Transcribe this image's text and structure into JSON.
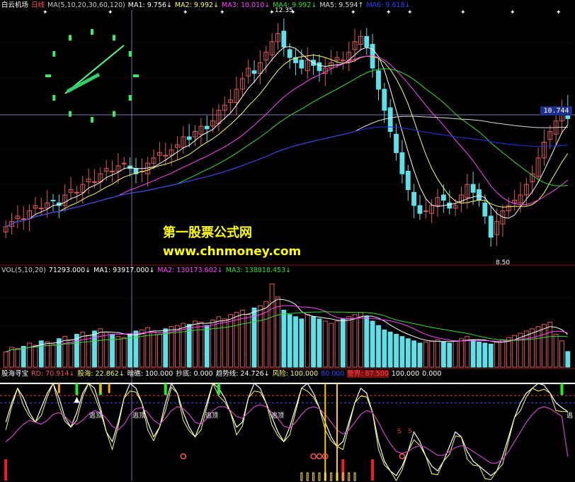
{
  "colors": {
    "background": "#000000",
    "up_candle": "#e05a5a",
    "down_candle": "#5fe0e8",
    "ma1": "#ffffff",
    "ma2": "#ffff66",
    "ma3": "#ff44ff",
    "ma4": "#33dd33",
    "ma5": "#dddddd",
    "ma6": "#2233ee",
    "hline": "#6a6a90",
    "osc_white": "#ffffff",
    "osc_yellow": "#ffff66",
    "osc_magenta": "#cc44cc",
    "osc_green": "#22ee22",
    "osc_orange": "#ffaa00",
    "osc_red": "#ee2222"
  },
  "header": {
    "title": "白云机场",
    "period": "日线",
    "ma_params": "MA(5,10,20,30,60,120)",
    "ma1": "MA1: 9.756↓",
    "ma2": "MA2: 9.992↓",
    "ma3": "MA3: 10.010↓",
    "ma4": "MA4: 9.992↓",
    "ma5": "MA5: 9.594↑",
    "ma6": "MA6: 9.618↓"
  },
  "vol_header": {
    "params": "VOL(5,10,20)",
    "vol": "71293.000↓",
    "ma1": "MA1: 93917.000↓",
    "ma2": "MA2: 130173.602↓",
    "ma3": "MA3: 138818.453↓"
  },
  "osc_header": {
    "name": "股海寻宝",
    "rd": "RD: 70.914↓",
    "gh": "股海: 22.862↓",
    "aj": "暗礁: 100.000",
    "cd": "抄底: 0.000",
    "qs": "趋势线: 24.726↓",
    "fx": "风险: 100.000",
    "v80": "80.000",
    "jj": "警界: 87.500",
    "v100": "100.000",
    "v0": "0.000"
  },
  "watermark": {
    "line1": "第一股票公式网",
    "line2": "www.chnmoney.com"
  },
  "labels": {
    "high_price": "12.35",
    "low_price": "8.50",
    "current_price": "10.744",
    "escape_signal": "逃顶",
    "escape_signal_cut": "逃",
    "signal_s": "S"
  },
  "chart_data": [
    {
      "type": "line",
      "title": "",
      "series": [
        {
          "name": "close",
          "values": [
            8.7,
            8.8,
            8.9,
            8.85,
            9.0,
            9.1,
            9.05,
            9.15,
            9.2,
            9.1,
            9.3,
            9.4,
            9.35,
            9.5,
            9.6,
            9.55,
            9.7,
            9.8,
            9.75,
            9.85,
            9.9,
            9.8,
            9.7,
            9.75,
            9.9,
            10.0,
            10.1,
            10.05,
            10.15,
            10.25,
            10.4,
            10.35,
            10.5,
            10.6,
            10.55,
            10.7,
            10.9,
            11.0,
            11.1,
            11.3,
            11.5,
            11.7,
            11.6,
            11.8,
            12.0,
            12.2,
            12.35,
            12.1,
            11.9,
            11.8,
            11.7,
            11.85,
            11.75,
            11.65,
            11.7,
            11.8,
            11.9,
            11.85,
            12.0,
            12.2,
            12.3,
            12.1,
            11.7,
            11.3,
            10.9,
            10.5,
            10.1,
            9.7,
            9.4,
            9.1,
            8.95,
            9.0,
            9.1,
            9.25,
            9.2,
            9.05,
            9.1,
            9.3,
            9.5,
            9.35,
            9.2,
            8.9,
            8.5,
            8.8,
            9.0,
            9.1,
            9.2,
            9.3,
            9.5,
            9.7,
            10.0,
            10.3,
            10.5,
            10.7,
            10.9,
            10.744
          ]
        }
      ],
      "ylim": [
        8.0,
        12.8
      ]
    },
    {
      "type": "bar",
      "title": "",
      "series": [
        {
          "name": "VOL",
          "values": [
            70000,
            90000,
            85000,
            95000,
            110000,
            100000,
            120000,
            115000,
            105000,
            130000,
            140000,
            125000,
            150000,
            160000,
            145000,
            165000,
            175000,
            160000,
            150000,
            140000,
            135000,
            150000,
            165000,
            170000,
            180000,
            160000,
            150000,
            175000,
            185000,
            190000,
            200000,
            195000,
            210000,
            205000,
            190000,
            215000,
            230000,
            220000,
            240000,
            250000,
            260000,
            240000,
            270000,
            280000,
            300000,
            380000,
            320000,
            260000,
            240000,
            230000,
            220000,
            240000,
            230000,
            220000,
            210000,
            200000,
            210000,
            220000,
            230000,
            240000,
            250000,
            230000,
            210000,
            190000,
            170000,
            160000,
            150000,
            140000,
            130000,
            120000,
            110000,
            115000,
            120000,
            125000,
            115000,
            110000,
            120000,
            130000,
            140000,
            125000,
            115000,
            110000,
            105000,
            115000,
            125000,
            135000,
            145000,
            155000,
            165000,
            175000,
            185000,
            195000,
            205000,
            150000,
            120000,
            71293
          ]
        }
      ],
      "ylim": [
        0,
        420000
      ]
    },
    {
      "type": "line",
      "title": "",
      "series": [
        {
          "name": "RD",
          "values": [
            60,
            80,
            95,
            85,
            70,
            60,
            75,
            90,
            100,
            85,
            65,
            55,
            70,
            90,
            100,
            95,
            75,
            50,
            40,
            60,
            85,
            100,
            95,
            80,
            60,
            45,
            55,
            80,
            100,
            90,
            70,
            55,
            45,
            60,
            80,
            100,
            95,
            85,
            70,
            55,
            60,
            85,
            100,
            95,
            80,
            65,
            50,
            40,
            55,
            75,
            95,
            100,
            90,
            75,
            60,
            45,
            35,
            40,
            60,
            80,
            95,
            90,
            70,
            40,
            20,
            10,
            5,
            15,
            30,
            50,
            40,
            25,
            15,
            10,
            20,
            35,
            50,
            45,
            30,
            20,
            15,
            10,
            5,
            10,
            25,
            45,
            65,
            80,
            90,
            95,
            100,
            98,
            90,
            80,
            75,
            70.914
          ]
        },
        {
          "name": "趋势线",
          "values": [
            40,
            45,
            52,
            58,
            62,
            60,
            58,
            62,
            68,
            70,
            66,
            60,
            58,
            62,
            68,
            72,
            70,
            64,
            56,
            52,
            58,
            68,
            74,
            75,
            70,
            62,
            58,
            64,
            72,
            76,
            74,
            68,
            60,
            58,
            64,
            72,
            76,
            76,
            72,
            66,
            64,
            70,
            76,
            78,
            76,
            70,
            64,
            56,
            54,
            60,
            68,
            74,
            76,
            74,
            68,
            60,
            52,
            48,
            52,
            60,
            68,
            72,
            70,
            60,
            48,
            38,
            30,
            28,
            30,
            34,
            36,
            34,
            30,
            26,
            26,
            30,
            34,
            36,
            34,
            30,
            26,
            22,
            18,
            18,
            22,
            30,
            40,
            50,
            60,
            68,
            74,
            76,
            74,
            70,
            66,
            24.726
          ]
        }
      ],
      "ylim": [
        0,
        105
      ]
    }
  ]
}
